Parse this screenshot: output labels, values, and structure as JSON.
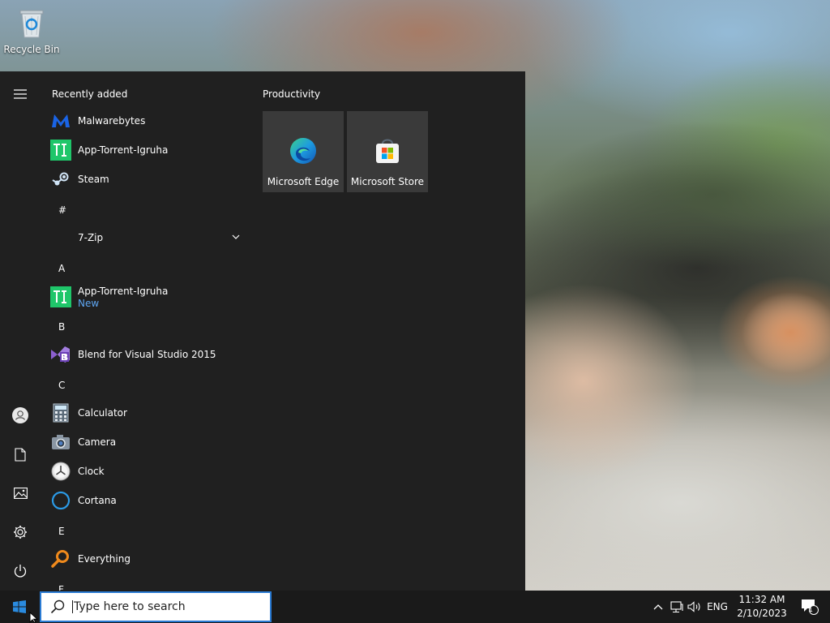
{
  "desktop": {
    "icons": [
      {
        "label": "Recycle Bin",
        "icon": "recycle-bin-icon"
      }
    ]
  },
  "start_menu": {
    "rail": {
      "items": [
        {
          "name": "expand-menu",
          "icon": "hamburger-icon"
        },
        {
          "name": "account",
          "icon": "user-icon"
        },
        {
          "name": "documents",
          "icon": "document-icon"
        },
        {
          "name": "pictures",
          "icon": "pictures-icon"
        },
        {
          "name": "settings",
          "icon": "gear-icon"
        },
        {
          "name": "power",
          "icon": "power-icon"
        }
      ]
    },
    "recently_added_title": "Recently added",
    "recently_added": [
      {
        "label": "Malwarebytes",
        "icon": "malwarebytes-icon"
      },
      {
        "label": "App-Torrent-Igruha",
        "icon": "app-torrent-igruha-icon"
      },
      {
        "label": "Steam",
        "icon": "steam-icon"
      }
    ],
    "sections": [
      {
        "letter": "#",
        "items": [
          {
            "label": "7-Zip",
            "icon": "folder-icon",
            "expandable": true
          }
        ]
      },
      {
        "letter": "A",
        "items": [
          {
            "label": "App-Torrent-Igruha",
            "sublabel": "New",
            "icon": "app-torrent-igruha-icon"
          }
        ]
      },
      {
        "letter": "B",
        "items": [
          {
            "label": "Blend for Visual Studio 2015",
            "icon": "blend-icon"
          }
        ]
      },
      {
        "letter": "C",
        "items": [
          {
            "label": "Calculator",
            "icon": "calculator-icon"
          },
          {
            "label": "Camera",
            "icon": "camera-icon"
          },
          {
            "label": "Clock",
            "icon": "clock-icon"
          },
          {
            "label": "Cortana",
            "icon": "cortana-icon"
          }
        ]
      },
      {
        "letter": "E",
        "items": [
          {
            "label": "Everything",
            "icon": "everything-icon"
          }
        ]
      },
      {
        "letter": "F",
        "items": []
      }
    ],
    "tiles_group_title": "Productivity",
    "tiles": [
      {
        "label": "Microsoft Edge",
        "icon": "edge-icon"
      },
      {
        "label": "Microsoft Store",
        "icon": "store-icon"
      }
    ]
  },
  "taskbar": {
    "start_icon": "windows-logo-icon",
    "search_placeholder": "Type here to search",
    "tray": {
      "language": "ENG",
      "time": "11:32 AM",
      "date": "2/10/2023",
      "notification_count": "1",
      "icons": [
        "chevron-up-icon",
        "network-icon",
        "volume-icon",
        "notification-icon"
      ]
    }
  },
  "colors": {
    "start_menu_bg": "#202020",
    "tile_bg": "#3a3a3a",
    "taskbar_bg": "#1a1a1a",
    "accent": "#2b7bd3",
    "new_badge": "#5ea6f2"
  }
}
